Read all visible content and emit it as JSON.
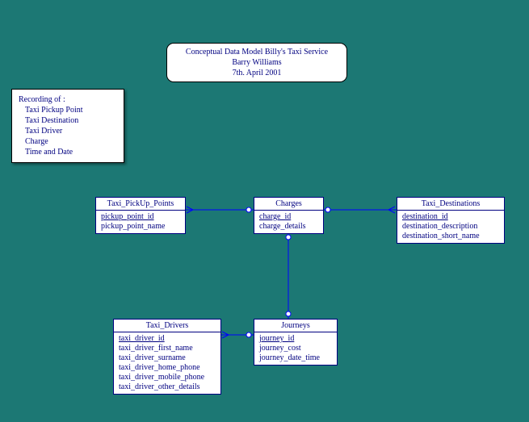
{
  "title": {
    "line1": "Conceptual Data Model Billy's Taxi Service",
    "line2": "Barry Williams",
    "line3": "7th. April 2001"
  },
  "note": {
    "heading": "Recording of :",
    "items": [
      "Taxi Pickup Point",
      "Taxi Destination",
      "Taxi Driver",
      "Charge",
      "Time and Date"
    ]
  },
  "entities": {
    "pickup": {
      "name": "Taxi_PickUp_Points",
      "attrs": [
        "pickup_point_id",
        "pickup_point_name"
      ]
    },
    "charges": {
      "name": "Charges",
      "attrs": [
        "charge_id",
        "charge_details"
      ]
    },
    "dest": {
      "name": "Taxi_Destinations",
      "attrs": [
        "destination_id",
        "destination_description",
        "destination_short_name"
      ]
    },
    "drivers": {
      "name": "Taxi_Drivers",
      "attrs": [
        "taxi_driver_id",
        "taxi_driver_first_name",
        "taxi_driver_surname",
        "taxi_driver_home_phone",
        "taxi_driver_mobile_phone",
        "taxi_driver_other_details"
      ]
    },
    "journeys": {
      "name": "Journeys",
      "attrs": [
        "journey_id",
        "journey_cost",
        "journey_date_time"
      ]
    }
  }
}
